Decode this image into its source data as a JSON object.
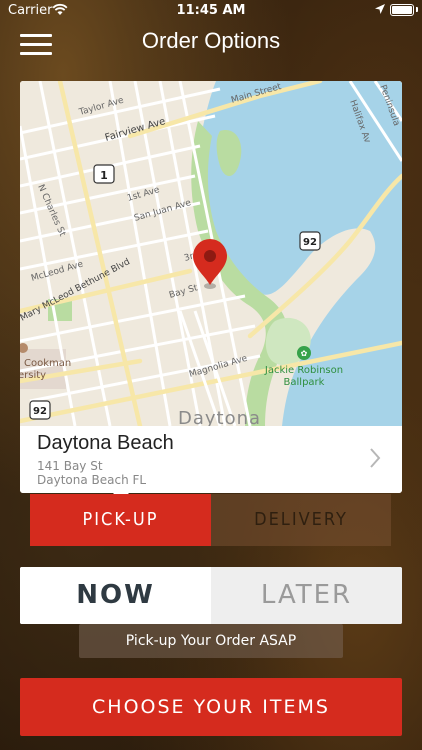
{
  "status_bar": {
    "carrier": "Carrier",
    "time": "11:45 AM"
  },
  "nav": {
    "title": "Order Options"
  },
  "map": {
    "streets": [
      "Main Street",
      "Taylor Ave",
      "Fairview Ave",
      "1st Ave",
      "San Juan Ave",
      "N Charles St",
      "McLeod Ave",
      "Mary McLeod Bethune Blvd",
      "Bay St",
      "3rd",
      "Magnolia Ave",
      "Halifax Av",
      "Peninsula"
    ],
    "shields": [
      "1",
      "92",
      "92"
    ],
    "places": [
      "Jackie Robinson",
      "Ballpark",
      "Cookman",
      "ersity",
      "Daytona"
    ]
  },
  "location": {
    "name": "Daytona Beach",
    "address_line1": "141 Bay St",
    "address_line2": "Daytona Beach FL"
  },
  "order_type": {
    "pickup_label": "PICK-UP",
    "delivery_label": "DELIVERY",
    "selected": "pickup"
  },
  "timing": {
    "now_label": "NOW",
    "later_label": "LATER",
    "selected": "now"
  },
  "hint": "Pick-up Your Order ASAP",
  "cta": "CHOOSE YOUR ITEMS",
  "colors": {
    "accent": "#d52b1e",
    "water": "#a6d3e8",
    "park": "#b9dca1"
  }
}
